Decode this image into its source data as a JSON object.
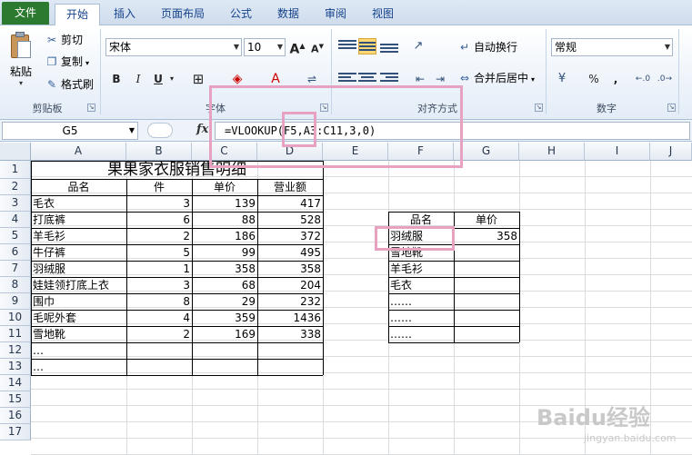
{
  "tabs": [
    {
      "label": "文件"
    },
    {
      "label": "开始"
    },
    {
      "label": "插入"
    },
    {
      "label": "页面布局"
    },
    {
      "label": "公式"
    },
    {
      "label": "数据"
    },
    {
      "label": "审阅"
    },
    {
      "label": "视图"
    }
  ],
  "clipboard": {
    "paste_label": "粘贴",
    "cut_label": "剪切",
    "copy_label": "复制",
    "format_painter_label": "格式刷",
    "group_label": "剪贴板"
  },
  "font": {
    "name": "宋体",
    "size": "10",
    "grow_label": "A",
    "shrink_label": "A",
    "bold_label": "B",
    "italic_label": "I",
    "underline_label": "U",
    "group_label": "字体"
  },
  "alignment": {
    "wrap_text_label": "自动换行",
    "merge_center_label": "合并后居中",
    "group_label": "对齐方式"
  },
  "number": {
    "format": "常规",
    "percent_label": "%",
    "comma_label": ",",
    "group_label": "数字"
  },
  "formula_bar": {
    "name_box": "G5",
    "fx_label": "fx",
    "formula": "=VLOOKUP(F5,A3:C11,3,0)"
  },
  "columns": [
    "A",
    "B",
    "C",
    "D",
    "E",
    "F",
    "G",
    "H",
    "I",
    "J"
  ],
  "rows": [
    "1",
    "2",
    "3",
    "4",
    "5",
    "6",
    "7",
    "8",
    "9",
    "10",
    "11",
    "12",
    "13",
    "14",
    "15",
    "16",
    "17"
  ],
  "sheet": {
    "title": "果果家衣服销售明细",
    "headers": [
      "品名",
      "件",
      "单价",
      "营业额"
    ],
    "data": [
      [
        "毛衣",
        "3",
        "139",
        "417"
      ],
      [
        "打底裤",
        "6",
        "88",
        "528"
      ],
      [
        "羊毛衫",
        "2",
        "186",
        "372"
      ],
      [
        "牛仔裤",
        "5",
        "99",
        "495"
      ],
      [
        "羽绒服",
        "1",
        "358",
        "358"
      ],
      [
        "娃娃领打底上衣",
        "3",
        "68",
        "204"
      ],
      [
        "围巾",
        "8",
        "29",
        "232"
      ],
      [
        "毛呢外套",
        "4",
        "359",
        "1436"
      ],
      [
        "雪地靴",
        "2",
        "169",
        "338"
      ],
      [
        "…",
        "",
        "",
        ""
      ],
      [
        "…",
        "",
        "",
        ""
      ]
    ]
  },
  "lookup": {
    "headers": [
      "品名",
      "单价"
    ],
    "rows": [
      [
        "羽绒服",
        "358"
      ],
      [
        "雪地靴",
        ""
      ],
      [
        "羊毛衫",
        ""
      ],
      [
        "毛衣",
        ""
      ],
      [
        "……",
        ""
      ],
      [
        "……",
        ""
      ],
      [
        "……",
        ""
      ]
    ]
  },
  "watermark": {
    "brand": "Baidu经验",
    "url": "jingyan.baidu.com"
  },
  "highlight_color": "#e7a1c1",
  "file_tab_color": "#2b7a2f"
}
